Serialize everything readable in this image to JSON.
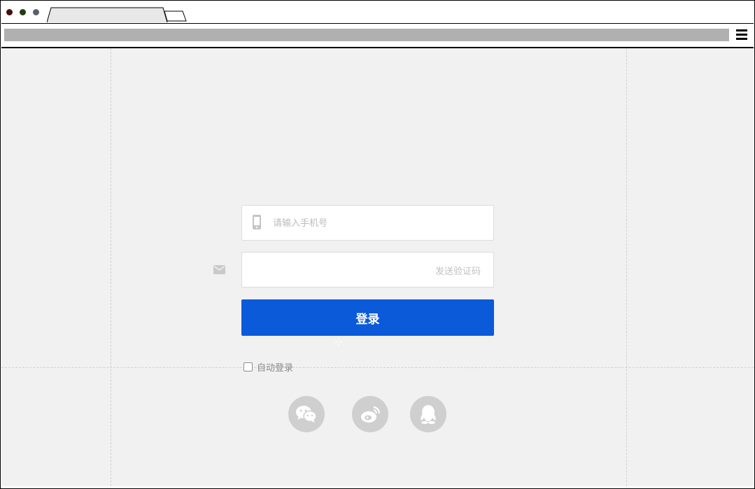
{
  "login_form": {
    "phone_placeholder": "请输入手机号",
    "code_placeholder": "",
    "send_code_label": "发送验证码",
    "login_button_label": "登录",
    "auto_login_label": "自动登录",
    "auto_login_checked": false
  },
  "social_login": [
    {
      "icon": "wechat-icon"
    },
    {
      "icon": "weibo-icon"
    },
    {
      "icon": "qq-icon"
    }
  ],
  "colors": {
    "primary_button": "#0a5ad9",
    "page_background": "#f1f1f1",
    "social_icon_bg": "#cfcfcf",
    "placeholder_text": "#bcbcbc"
  }
}
